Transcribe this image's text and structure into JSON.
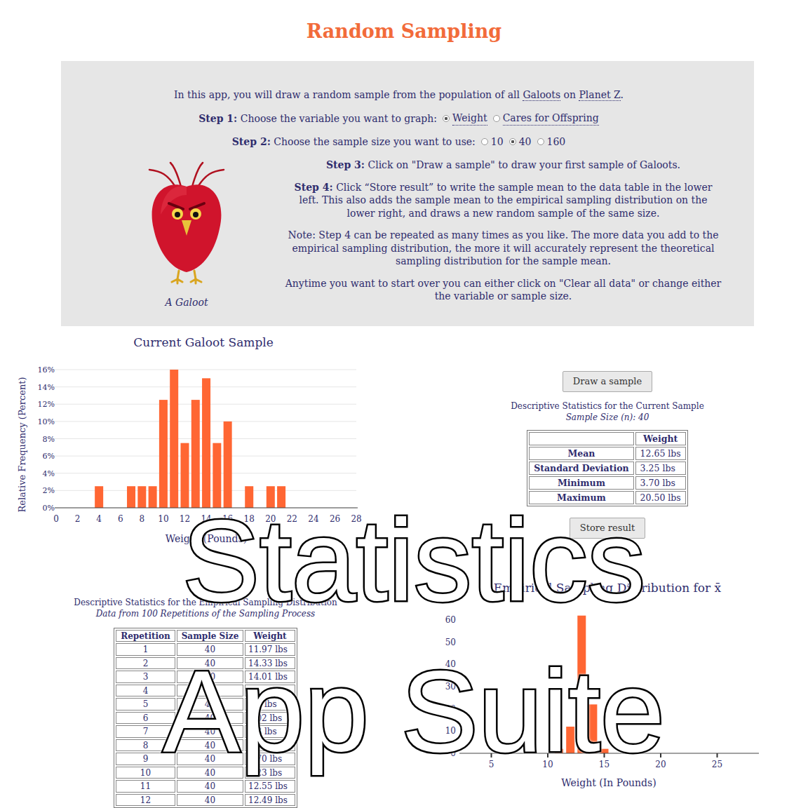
{
  "page": {
    "title": "Random Sampling"
  },
  "intro": {
    "parts": [
      {
        "text": "In this app, you will draw a random sample from the population of all ",
        "link": false
      },
      {
        "text": "Galoots",
        "link": true
      },
      {
        "text": " on ",
        "link": false
      },
      {
        "text": "Planet Z",
        "link": true
      },
      {
        "text": ".",
        "link": false
      }
    ]
  },
  "step1": {
    "label": "Step 1:",
    "text": "Choose the variable you want to graph:",
    "options": [
      {
        "label": "Weight",
        "selected": true
      },
      {
        "label": "Cares for Offspring",
        "selected": false
      }
    ]
  },
  "step2": {
    "label": "Step 2:",
    "text": "Choose the sample size you want to use:",
    "options": [
      {
        "label": "10",
        "selected": false
      },
      {
        "label": "40",
        "selected": true
      },
      {
        "label": "160",
        "selected": false
      }
    ]
  },
  "image": {
    "caption": "A Galoot"
  },
  "steps": [
    {
      "label": "Step 3:",
      "text": "Click on \"Draw a sample\" to draw your first sample of Galoots."
    },
    {
      "label": "Step 4:",
      "text": "Click “Store result” to write the sample mean to the data table in the lower left. This also adds the sample mean to the empirical sampling distribution on the lower right, and draws a new random sample of the same size."
    }
  ],
  "notes": [
    "Note: Step 4 can be repeated as many times as you like. The more data you add to the empirical sampling distribution, the more it will accurately represent the theoretical sampling distribution for the sample mean.",
    "Anytime you want to start over you can either click on \"Clear all data\" or change either the variable or sample size."
  ],
  "sample_chart": {
    "title": "Current Galoot Sample",
    "y_label": "Relative Frequency (Percent)",
    "x_label": "Weight (Pounds)",
    "y_ticks": [
      "0%",
      "2%",
      "4%",
      "6%",
      "8%",
      "10%",
      "12%",
      "14%",
      "16%"
    ],
    "x_ticks": [
      "0",
      "2",
      "4",
      "6",
      "8",
      "10",
      "12",
      "14",
      "16",
      "18",
      "20",
      "22",
      "24",
      "26",
      "28"
    ],
    "bars": [
      {
        "x": 4,
        "value": 2.5
      },
      {
        "x": 7,
        "value": 2.5
      },
      {
        "x": 8,
        "value": 2.5
      },
      {
        "x": 9,
        "value": 2.5
      },
      {
        "x": 10,
        "value": 12.5
      },
      {
        "x": 11,
        "value": 16
      },
      {
        "x": 12,
        "value": 7.5
      },
      {
        "x": 13,
        "value": 12.5
      },
      {
        "x": 14,
        "value": 15
      },
      {
        "x": 15,
        "value": 7.5
      },
      {
        "x": 16,
        "value": 10
      },
      {
        "x": 18,
        "value": 2.5
      },
      {
        "x": 20,
        "value": 2.5
      },
      {
        "x": 21,
        "value": 2.5
      }
    ]
  },
  "current_stats": {
    "draw_button": "Draw a sample",
    "caption": "Descriptive Statistics for the Current Sample",
    "sample_size": "Sample Size (n): 40",
    "column": "Weight",
    "rows": [
      {
        "label": "Mean",
        "value": "12.65 lbs"
      },
      {
        "label": "Standard Deviation",
        "value": "3.25 lbs"
      },
      {
        "label": "Minimum",
        "value": "3.70 lbs"
      },
      {
        "label": "Maximum",
        "value": "20.50 lbs"
      }
    ],
    "store_button": "Store result"
  },
  "empirical_table": {
    "caption": "Descriptive Statistics for the Empirical Sampling Distribution",
    "subcaption": "Data from 100 Repetitions of the Sampling Process",
    "columns": [
      "Repetition",
      "Sample Size",
      "Weight"
    ],
    "rows": [
      [
        "1",
        "40",
        "11.97 lbs"
      ],
      [
        "2",
        "40",
        "14.33 lbs"
      ],
      [
        "3",
        "40",
        "14.01 lbs"
      ],
      [
        "4",
        "40",
        ""
      ],
      [
        "5",
        "40",
        ".69 lbs"
      ],
      [
        "6",
        "40",
        "4.02 lbs"
      ],
      [
        "7",
        "40",
        ".93 lbs"
      ],
      [
        "8",
        "40",
        ""
      ],
      [
        "9",
        "40",
        "2.70 lbs"
      ],
      [
        "10",
        "40",
        "3.23 lbs"
      ],
      [
        "11",
        "40",
        "12.55 lbs"
      ],
      [
        "12",
        "40",
        "12.49 lbs"
      ]
    ]
  },
  "empirical_chart": {
    "title": "Empirical Sampling Distribution for x̄",
    "x_label": "Weight (In Pounds)",
    "y_ticks": [
      "0",
      "10",
      "20",
      "30",
      "40",
      "50",
      "60"
    ],
    "x_ticks": [
      "5",
      "10",
      "15",
      "20",
      "25"
    ],
    "bars": [
      {
        "x": 11,
        "value": 2
      },
      {
        "x": 12,
        "value": 12
      },
      {
        "x": 13,
        "value": 62
      },
      {
        "x": 14,
        "value": 22
      },
      {
        "x": 15,
        "value": 2
      }
    ]
  },
  "overlay": {
    "lines": [
      "Statistics",
      "App Suite"
    ]
  }
}
